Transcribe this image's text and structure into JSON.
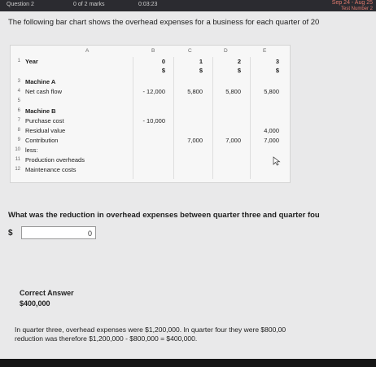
{
  "topbar": {
    "question": "Question 2",
    "marks": "0 of 2 marks",
    "timer": "0:03:23",
    "date_range": "Sep 24 - Aug 25",
    "test_number": "Test Number 2"
  },
  "prompt": "The following bar chart shows the overhead expenses for a business for each quarter of 20",
  "sheet": {
    "columns": [
      "A",
      "B",
      "C",
      "D",
      "E"
    ],
    "rows": [
      {
        "num": "1",
        "label": "Year",
        "cells": [
          "0",
          "1",
          "2",
          "3"
        ]
      },
      {
        "num": "",
        "label": "",
        "cells": [
          "$",
          "$",
          "$",
          "$"
        ]
      },
      {
        "num": "3",
        "label": "Machine A",
        "cells": [
          "",
          "",
          "",
          ""
        ]
      },
      {
        "num": "4",
        "label": "Net cash flow",
        "cells": [
          "- 12,000",
          "5,800",
          "5,800",
          "5,800"
        ]
      },
      {
        "num": "5",
        "label": "",
        "cells": [
          "",
          "",
          "",
          ""
        ]
      },
      {
        "num": "6",
        "label": "Machine B",
        "cells": [
          "",
          "",
          "",
          ""
        ]
      },
      {
        "num": "7",
        "label": "Purchase cost",
        "cells": [
          "- 10,000",
          "",
          "",
          ""
        ]
      },
      {
        "num": "8",
        "label": "Residual value",
        "cells": [
          "",
          "",
          "",
          "4,000"
        ]
      },
      {
        "num": "9",
        "label": "Contribution",
        "cells": [
          "",
          "7,000",
          "7,000",
          "7,000"
        ]
      },
      {
        "num": "10",
        "label": "less:",
        "cells": [
          "",
          "",
          "",
          ""
        ]
      },
      {
        "num": "11",
        "label": "Production overheads",
        "cells": [
          "",
          "",
          "",
          ""
        ]
      },
      {
        "num": "12",
        "label": "Maintenance costs",
        "cells": [
          "",
          "",
          "",
          ""
        ]
      }
    ]
  },
  "question": "What was the reduction in overhead expenses between quarter three and quarter fou",
  "answer": {
    "currency": "$",
    "value": "0"
  },
  "correct": {
    "title": "Correct Answer",
    "value": "$400,000"
  },
  "explanation": {
    "line1": "In quarter three, overhead expenses were $1,200,000.  In quarter four they were $800,00",
    "line2": "reduction was therefore $1,200,000 - $800,000 = $400,000."
  }
}
